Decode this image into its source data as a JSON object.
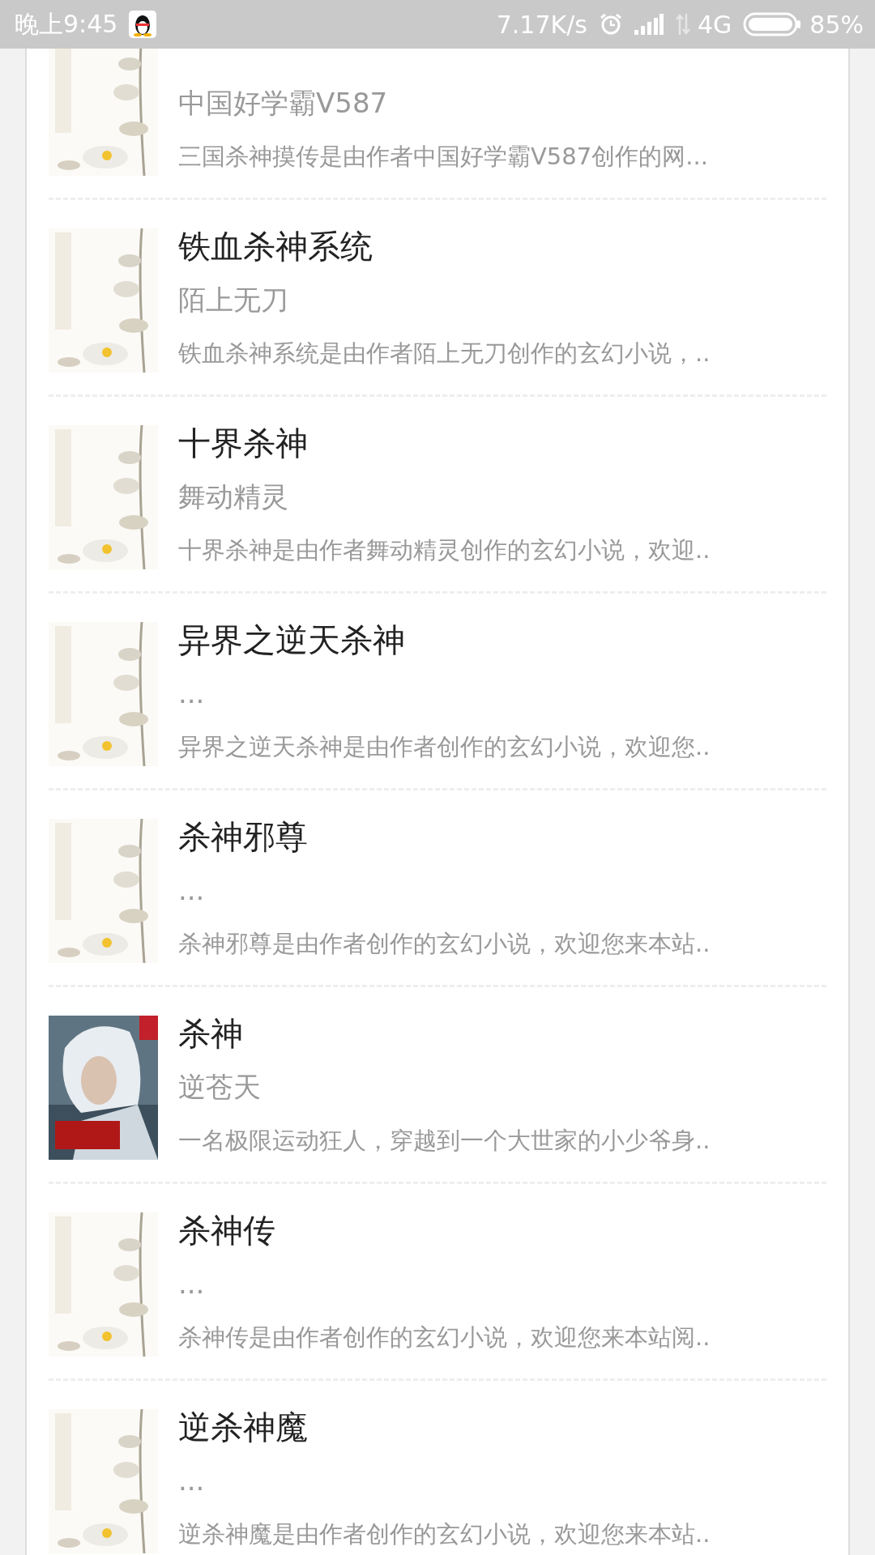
{
  "status_bar": {
    "time": "晚上9:45",
    "network_speed": "7.17K/s",
    "network_type": "4G",
    "battery": "85%"
  },
  "books": [
    {
      "author": "中国好学霸V587",
      "summary": "三国杀神摸传是由作者中国好学霸V587创作的网..."
    },
    {
      "title": "铁血杀神系统",
      "author": "陌上无刀",
      "summary": "铁血杀神系统是由作者陌上无刀创作的玄幻小说，.."
    },
    {
      "title": "十界杀神",
      "author": "舞动精灵",
      "summary": "十界杀神是由作者舞动精灵创作的玄幻小说，欢迎.."
    },
    {
      "title": "异界之逆天杀神",
      "author": "...",
      "summary": "异界之逆天杀神是由作者创作的玄幻小说，欢迎您.."
    },
    {
      "title": "杀神邪尊",
      "author": "...",
      "summary": "杀神邪尊是由作者创作的玄幻小说，欢迎您来本站.."
    },
    {
      "title": "杀神",
      "author": "逆苍天",
      "summary": "一名极限运动狂人，穿越到一个大世家的小少爷身.."
    },
    {
      "title": "杀神传",
      "author": "...",
      "summary": "杀神传是由作者创作的玄幻小说，欢迎您来本站阅.."
    },
    {
      "title": "逆杀神魔",
      "author": "...",
      "summary": "逆杀神魔是由作者创作的玄幻小说，欢迎您来本站.."
    }
  ]
}
